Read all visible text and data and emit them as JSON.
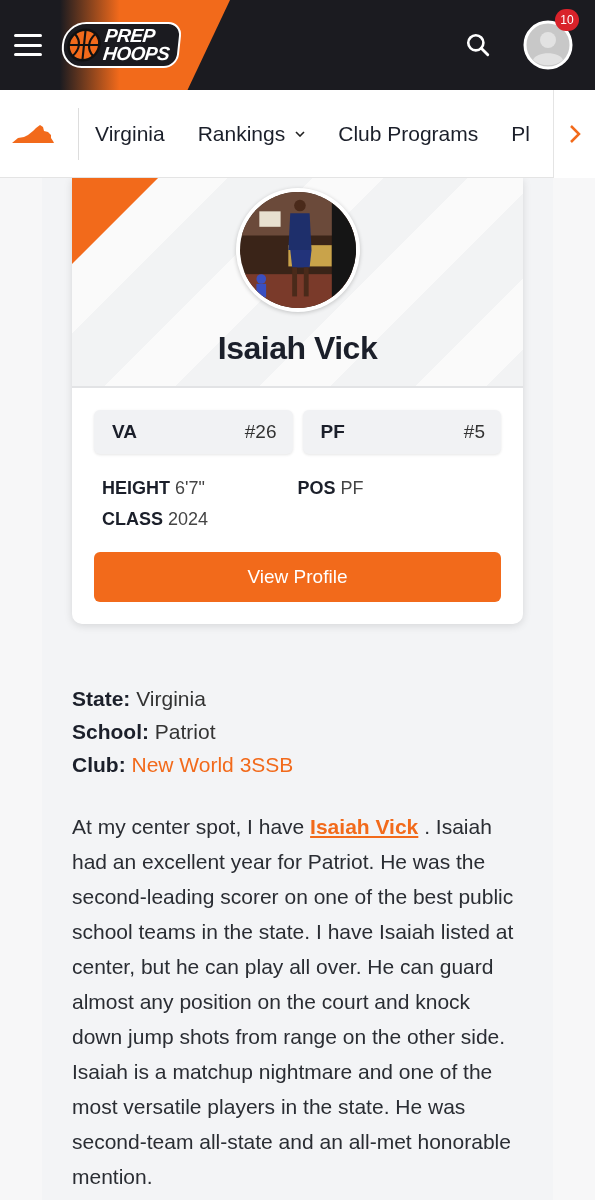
{
  "header": {
    "logo": [
      "PREP",
      "HOOPS"
    ],
    "notification_count": "10"
  },
  "nav": {
    "items": [
      {
        "label": "Virginia",
        "dropdown": false
      },
      {
        "label": "Rankings",
        "dropdown": true
      },
      {
        "label": "Club Programs",
        "dropdown": false
      },
      {
        "label": "Pl",
        "dropdown": false
      }
    ]
  },
  "player_card": {
    "name": "Isaiah Vick",
    "ranks": [
      {
        "label": "VA",
        "rank": "#26"
      },
      {
        "label": "PF",
        "rank": "#5"
      }
    ],
    "stats": [
      {
        "label": "HEIGHT",
        "value": "6'7\""
      },
      {
        "label": "POS",
        "value": "PF"
      },
      {
        "label": "CLASS",
        "value": "2024"
      }
    ],
    "button": "View Profile"
  },
  "info": [
    {
      "label": "State:",
      "value": "Virginia",
      "link": false
    },
    {
      "label": "School:",
      "value": "Patriot",
      "link": false
    },
    {
      "label": "Club:",
      "value": "New World 3SSB",
      "link": true
    }
  ],
  "paragraph": {
    "before": "At my center spot, I have ",
    "link": "Isaiah Vick",
    "after": " . Isaiah had an excellent year for Patriot. He was the second-leading scorer on one of the best public school teams in the state. I have Isaiah listed at center, but he can play all over. He can guard almost any position on the court and knock down jump shots from range on the other side. Isaiah is a matchup nightmare and one of the most versatile players in the state. He was second-team all-state and an all-met honorable mention."
  }
}
